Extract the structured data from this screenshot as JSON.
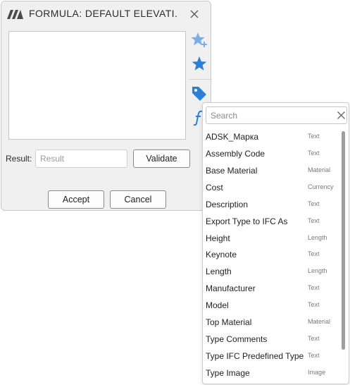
{
  "dialog": {
    "title": "FORMULA: DEFAULT ELEVATI...",
    "result_label": "Result:",
    "result_placeholder": "Result",
    "validate_label": "Validate",
    "accept_label": "Accept",
    "cancel_label": "Cancel"
  },
  "side_icons": [
    "star-plus-icon",
    "star-icon",
    "tag-icon",
    "function-icon"
  ],
  "colors": {
    "accent": "#2b7fd8",
    "accent_light": "#7aaee8"
  },
  "dropdown": {
    "search_placeholder": "Search",
    "items": [
      {
        "name": "ADSK_Марка",
        "type": "Text"
      },
      {
        "name": "Assembly Code",
        "type": "Text"
      },
      {
        "name": "Base Material",
        "type": "Material"
      },
      {
        "name": "Cost",
        "type": "Currency"
      },
      {
        "name": "Description",
        "type": "Text"
      },
      {
        "name": "Export Type to IFC As",
        "type": "Text"
      },
      {
        "name": "Height",
        "type": "Length"
      },
      {
        "name": "Keynote",
        "type": "Text"
      },
      {
        "name": "Length",
        "type": "Length"
      },
      {
        "name": "Manufacturer",
        "type": "Text"
      },
      {
        "name": "Model",
        "type": "Text"
      },
      {
        "name": "Top Material",
        "type": "Material"
      },
      {
        "name": "Type Comments",
        "type": "Text"
      },
      {
        "name": "Type IFC Predefined Type",
        "type": "Text"
      },
      {
        "name": "Type Image",
        "type": "Image"
      }
    ]
  }
}
